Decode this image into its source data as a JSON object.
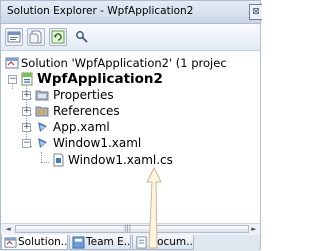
{
  "window": {
    "title": "Solution Explorer - WpfApplication2",
    "close_glyph": "⊠"
  },
  "toolbar": {
    "buttons": [
      {
        "name": "properties-icon"
      },
      {
        "name": "show-all-files-icon"
      },
      {
        "name": "refresh-icon"
      },
      {
        "name": "class-diagram-icon"
      }
    ]
  },
  "tree": {
    "solution_label": "Solution 'WpfApplication2' (1 projec",
    "project_label": "WpfApplication2",
    "items": [
      {
        "label": "Properties",
        "expander": "+"
      },
      {
        "label": "References",
        "expander": "+"
      },
      {
        "label": "App.xaml",
        "expander": "+"
      },
      {
        "label": "Window1.xaml",
        "expander": "−"
      },
      {
        "label": "Window1.xaml.cs"
      }
    ]
  },
  "scrollbar": {
    "left_arrow": "◄",
    "right_arrow": "►",
    "thumb_grip": "|||"
  },
  "tabs": [
    {
      "label": "Solution..."
    },
    {
      "label": "Team E..."
    },
    {
      "label": "Docum..."
    }
  ],
  "colors": {
    "accent": "#c9d6e7",
    "tree_background": "#ffffff"
  }
}
